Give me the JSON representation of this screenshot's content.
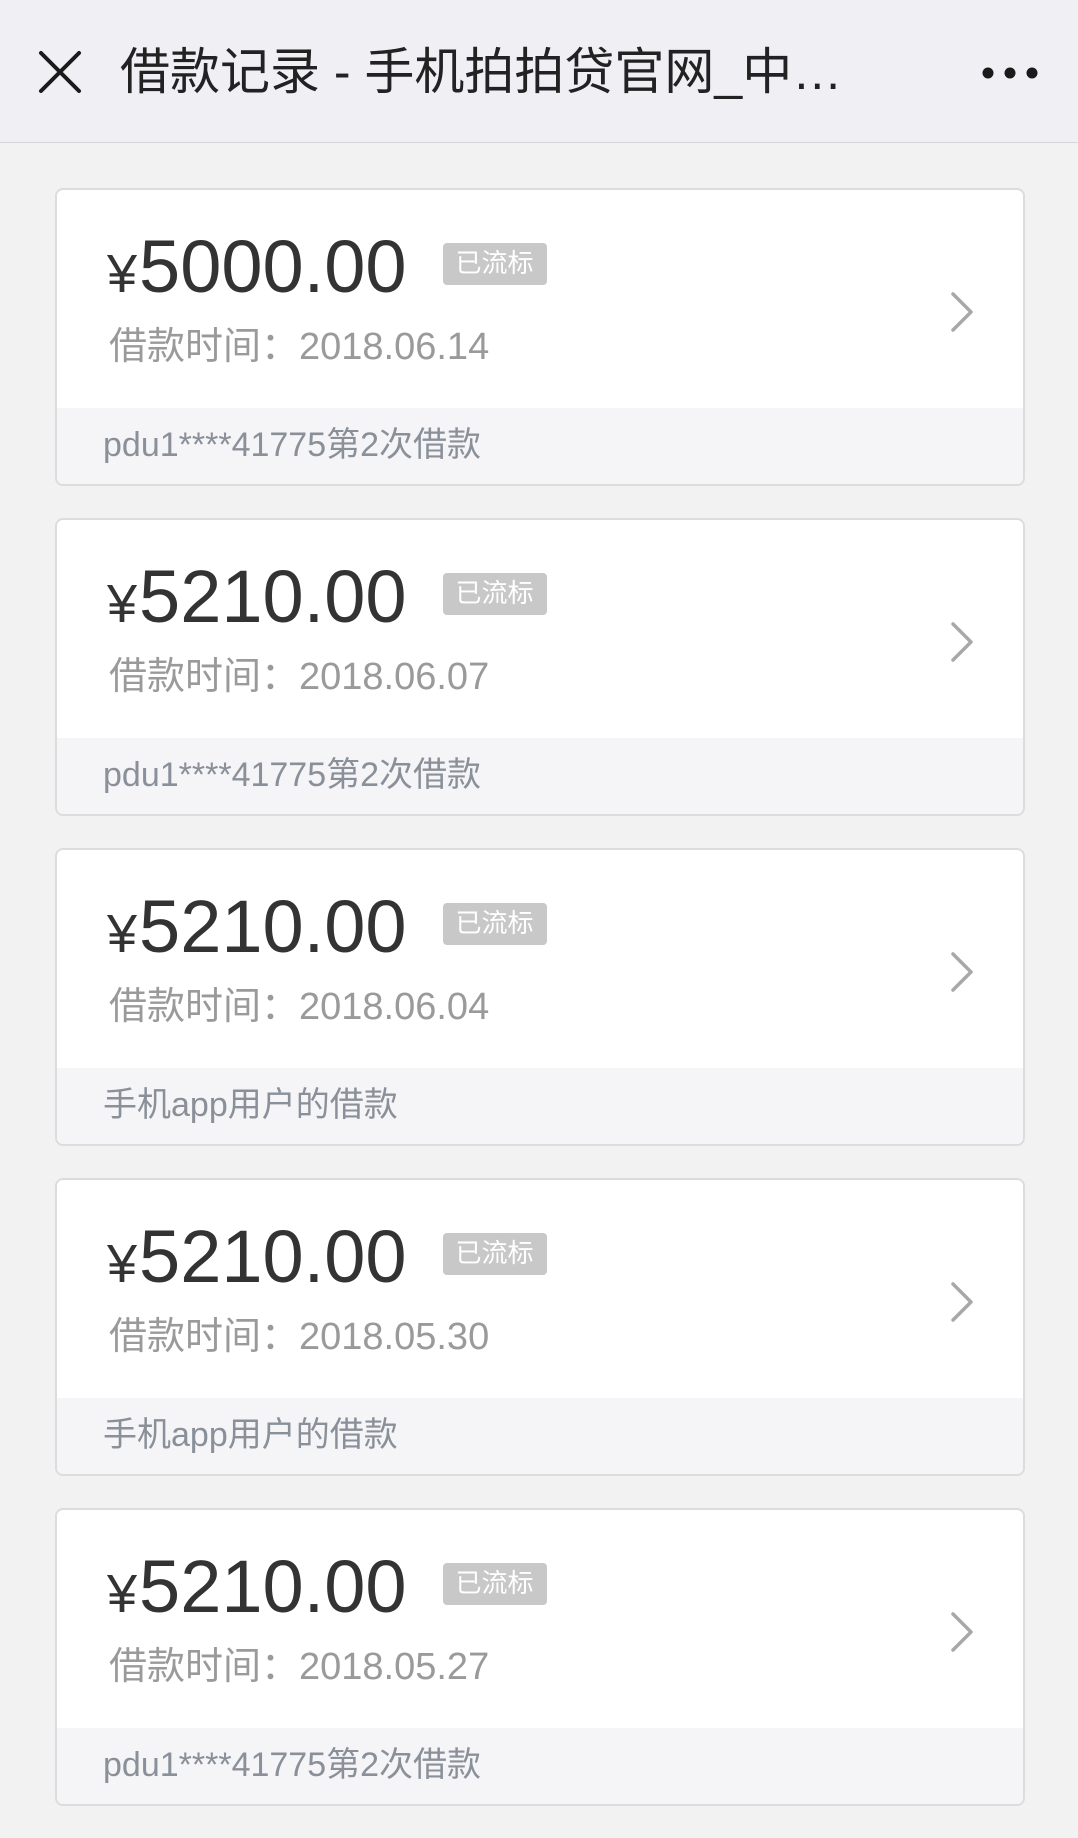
{
  "nav": {
    "close_icon": "close-icon",
    "title": "借款记录 - 手机拍拍贷官网_中…",
    "more_icon": "more-dots-icon"
  },
  "records": [
    {
      "currency": "¥",
      "amount": "5000.00",
      "badge": "已流标",
      "date_label": "借款时间：",
      "date": "2018.06.14",
      "desc": "pdu1****41775第2次借款"
    },
    {
      "currency": "¥",
      "amount": "5210.00",
      "badge": "已流标",
      "date_label": "借款时间：",
      "date": "2018.06.07",
      "desc": "pdu1****41775第2次借款"
    },
    {
      "currency": "¥",
      "amount": "5210.00",
      "badge": "已流标",
      "date_label": "借款时间：",
      "date": "2018.06.04",
      "desc": "手机app用户的借款"
    },
    {
      "currency": "¥",
      "amount": "5210.00",
      "badge": "已流标",
      "date_label": "借款时间：",
      "date": "2018.05.30",
      "desc": "手机app用户的借款"
    },
    {
      "currency": "¥",
      "amount": "5210.00",
      "badge": "已流标",
      "date_label": "借款时间：",
      "date": "2018.05.27",
      "desc": "pdu1****41775第2次借款"
    }
  ],
  "colors": {
    "background": "#f2f2f2",
    "card": "#ffffff",
    "badge": "#c8c8c8",
    "amount_text": "#333333",
    "muted_text": "#9a9a9a"
  }
}
